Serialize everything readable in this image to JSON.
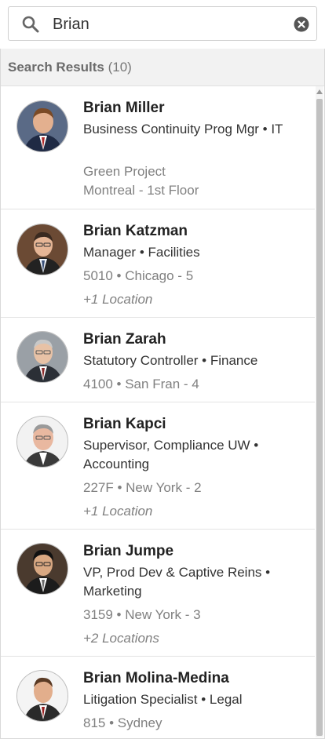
{
  "search": {
    "query": "Brian"
  },
  "results": {
    "label": "Search Results",
    "count": "(10)"
  },
  "people": [
    {
      "name": "Brian Miller",
      "title": "Business Continuity Prog Mgr • IT",
      "meta1": "Green Project",
      "meta2": "Montreal - 1st Floor",
      "extra": ""
    },
    {
      "name": "Brian Katzman",
      "title": "Manager • Facilities",
      "meta1": "5010 • Chicago - 5",
      "meta2": "",
      "extra": "+1 Location"
    },
    {
      "name": "Brian Zarah",
      "title": "Statutory Controller • Finance",
      "meta1": "4100 • San Fran - 4",
      "meta2": "",
      "extra": ""
    },
    {
      "name": "Brian Kapci",
      "title": "Supervisor, Compliance UW • Accounting",
      "meta1": "227F • New York - 2",
      "meta2": "",
      "extra": "+1 Location"
    },
    {
      "name": "Brian Jumpe",
      "title": "VP, Prod Dev & Captive Reins • Marketing",
      "meta1": "3159 • New York - 3",
      "meta2": "",
      "extra": "+2 Locations"
    },
    {
      "name": "Brian Molina-Medina",
      "title": "Litigation Specialist • Legal",
      "meta1": "815 • Sydney",
      "meta2": "",
      "extra": ""
    }
  ],
  "icons": {
    "search": "search-icon",
    "clear": "clear-icon",
    "avatar": "person-photo"
  },
  "colors": {
    "header_bg": "#f2f2f2",
    "muted_text": "#808080",
    "clear_icon": "#555555"
  }
}
